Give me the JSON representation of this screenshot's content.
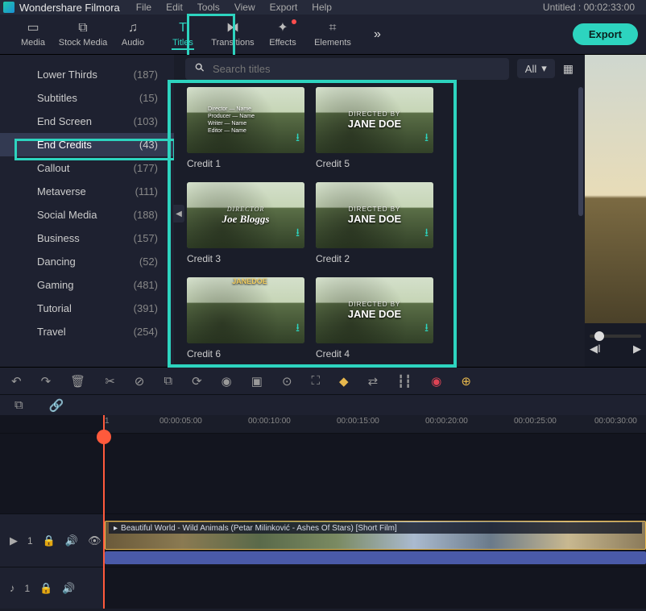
{
  "app": {
    "name": "Wondershare Filmora",
    "project": "Untitled : 00:02:33:00"
  },
  "menu": {
    "file": "File",
    "edit": "Edit",
    "tools": "Tools",
    "view": "View",
    "export": "Export",
    "help": "Help"
  },
  "tabs": {
    "media": "Media",
    "stock": "Stock Media",
    "audio": "Audio",
    "titles": "Titles",
    "transitions": "Transitions",
    "effects": "Effects",
    "elements": "Elements"
  },
  "export_btn": "Export",
  "search": {
    "placeholder": "Search titles"
  },
  "filter": {
    "label": "All"
  },
  "sidebar": {
    "items": [
      {
        "label": "Lower Thirds",
        "count": "(187)"
      },
      {
        "label": "Subtitles",
        "count": "(15)"
      },
      {
        "label": "End Screen",
        "count": "(103)"
      },
      {
        "label": "End Credits",
        "count": "(43)"
      },
      {
        "label": "Callout",
        "count": "(177)"
      },
      {
        "label": "Metaverse",
        "count": "(111)"
      },
      {
        "label": "Social Media",
        "count": "(188)"
      },
      {
        "label": "Business",
        "count": "(157)"
      },
      {
        "label": "Dancing",
        "count": "(52)"
      },
      {
        "label": "Gaming",
        "count": "(481)"
      },
      {
        "label": "Tutorial",
        "count": "(391)"
      },
      {
        "label": "Travel",
        "count": "(254)"
      }
    ]
  },
  "cards": [
    {
      "name": "Credit 1",
      "overlay": "",
      "style": "list"
    },
    {
      "name": "Credit 5",
      "overlay": "JANE DOE",
      "sub": "DIRECTED BY"
    },
    {
      "name": "Credit 3",
      "overlay": "Joe Bloggs",
      "sub": "DIRECTOR"
    },
    {
      "name": "Credit 2",
      "overlay": "JANE DOE",
      "sub": "DIRECTED BY"
    },
    {
      "name": "Credit 6",
      "overlay": "JANEDOE",
      "style": "side"
    },
    {
      "name": "Credit 4",
      "overlay": "JANE DOE",
      "sub": "DIRECTED BY"
    }
  ],
  "ruler": [
    "00:00:05:00",
    "00:00:10:00",
    "00:00:15:00",
    "00:00:20:00",
    "00:00:25:00",
    "00:00:30:00"
  ],
  "ruler_start": "1",
  "clip": {
    "title": "Beautiful World - Wild Animals (Petar Milinković - Ashes Of Stars) [Short Film]"
  },
  "trackhead": {
    "video": "1",
    "audio": "1"
  }
}
